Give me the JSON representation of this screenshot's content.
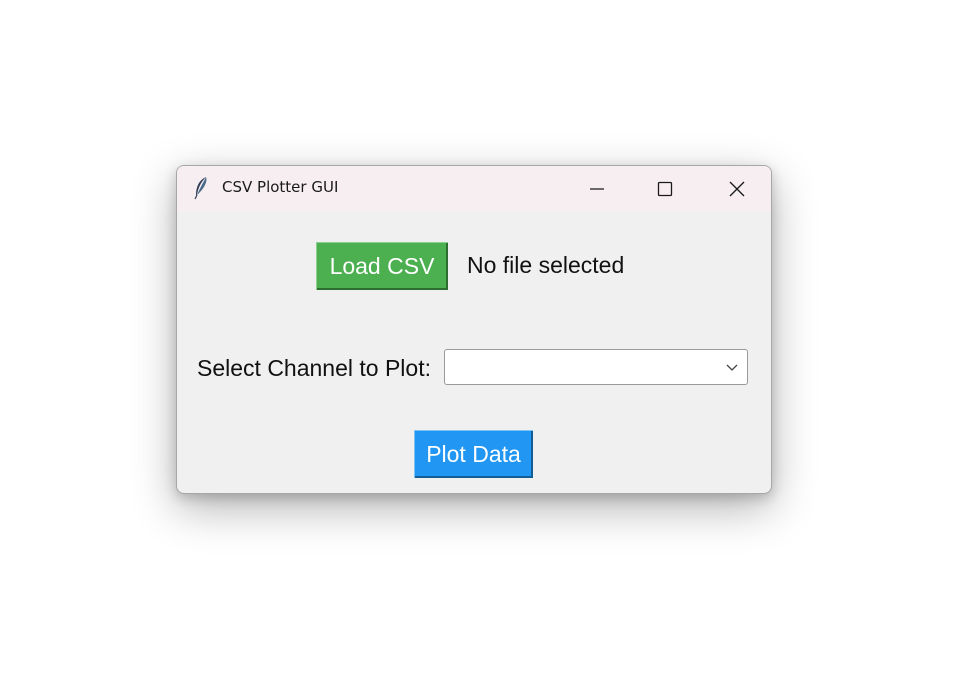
{
  "window": {
    "title": "CSV Plotter GUI",
    "controls": {
      "minimize": "minimize-icon",
      "maximize": "maximize-icon",
      "close": "close-icon"
    }
  },
  "main": {
    "load_button_label": "Load CSV",
    "file_status": "No file selected",
    "channel_label": "Select Channel to Plot:",
    "channel_select": {
      "value": "",
      "icon": "chevron-down-icon"
    },
    "plot_button_label": "Plot Data"
  },
  "colors": {
    "load_button": "#4caf50",
    "plot_button": "#2196f3",
    "titlebar": "#f7eef1",
    "window_bg": "#f0f0f0"
  }
}
